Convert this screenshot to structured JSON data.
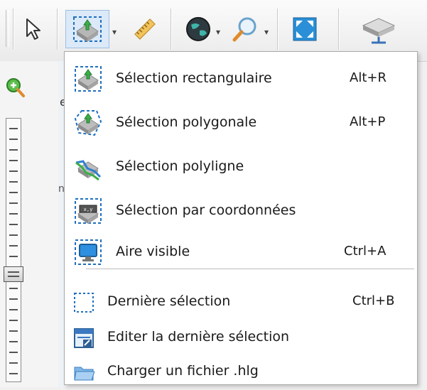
{
  "toolbar": {
    "buttons": [
      {
        "name": "pointer-icon"
      },
      {
        "name": "selection-icon"
      },
      {
        "name": "ruler-icon"
      },
      {
        "name": "globe-icon"
      },
      {
        "name": "zoom-lens-icon"
      },
      {
        "name": "full-extent-icon"
      },
      {
        "name": "server-icon"
      }
    ]
  },
  "menu": {
    "items": [
      {
        "label": "Sélection rectangulaire",
        "shortcut": "Alt+R",
        "icon": "rectangle-selection-icon"
      },
      {
        "label": "Sélection polygonale",
        "shortcut": "Alt+P",
        "icon": "polygon-selection-icon"
      },
      {
        "label": "Sélection polyligne",
        "shortcut": "",
        "icon": "polyline-selection-icon"
      },
      {
        "label": "Sélection par coordonnées",
        "shortcut": "",
        "icon": "coordinates-selection-icon"
      },
      {
        "label": "Aire visible",
        "shortcut": "Ctrl+A",
        "icon": "visible-area-icon"
      },
      {
        "label": "Dernière sélection",
        "shortcut": "Ctrl+B",
        "icon": "last-selection-icon"
      },
      {
        "label": "Editer la dernière sélection",
        "shortcut": "",
        "icon": "edit-selection-icon"
      },
      {
        "label": "Charger un fichier .hlg",
        "shortcut": "",
        "icon": "folder-icon"
      }
    ]
  },
  "leftbar": {
    "zoom_level_fraction": 0.58,
    "peek_texts": [
      "e",
      "na"
    ]
  },
  "colors": {
    "menu_background": "#ffffff",
    "active_button": "#dbe9f8",
    "selection_dash": "#1e6fbf"
  }
}
